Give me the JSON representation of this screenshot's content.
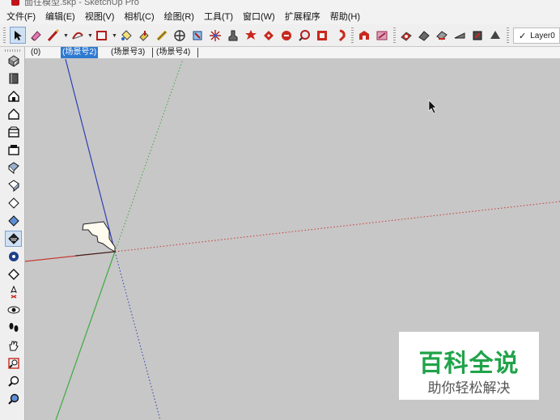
{
  "window": {
    "title_partial": "面往模型.skp - SketchUp Pro"
  },
  "menu": [
    "文件(F)",
    "编辑(E)",
    "视图(V)",
    "相机(C)",
    "绘图(R)",
    "工具(T)",
    "窗口(W)",
    "扩展程序",
    "帮助(H)"
  ],
  "layer": {
    "check": "✓",
    "name": "Layer0"
  },
  "scene_tabs": [
    "(0)",
    "(场景号2)",
    "(场景号3)",
    "(场景号4)"
  ],
  "active_scene_tab": "(场景号2)",
  "watermark": {
    "title": "百科全说",
    "subtitle": "助你轻松解决"
  },
  "colors": {
    "background": "#c7c7c7",
    "axis_red": "#c83a32",
    "axis_green": "#3faa3f",
    "axis_blue": "#2d3fb4",
    "tab_active": "#2f7ad1",
    "watermark_green": "#21a34a"
  },
  "icons": {
    "top_toolbar": [
      "select-arrow-icon",
      "eraser-icon",
      "pencil-line-icon",
      "arc-icon",
      "rectangle-icon",
      "paint-bucket-icon",
      "push-pull-icon",
      "tape-measure-icon",
      "move-icon",
      "rotate-icon",
      "scale-icon",
      "offset-icon",
      "follow-me-icon",
      "orbit-icon",
      "pan-icon",
      "zoom-icon",
      "section-plane-icon",
      "component-icon",
      "warehouse-icon",
      "extension-icon",
      "sandbox-icon",
      "style-icon",
      "layer-icon"
    ],
    "left_toolbar": [
      "component-icon",
      "book-icon",
      "house-iso-icon",
      "house-top-icon",
      "house-front-icon",
      "house-right-icon",
      "house-back-icon",
      "house-left-icon",
      "xray-icon",
      "back-edges-icon",
      "wireframe-icon",
      "hidden-line-icon",
      "shaded-icon",
      "shaded-texture-icon",
      "monochrome-icon",
      "position-camera-icon",
      "look-around-icon",
      "walk-icon",
      "hand-icon",
      "zoom-window-icon",
      "zoom-icon",
      "zoom-extents-icon"
    ]
  }
}
